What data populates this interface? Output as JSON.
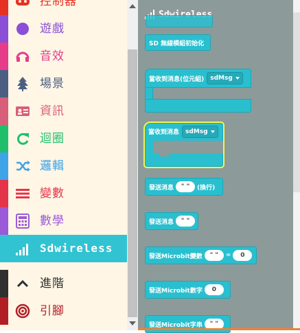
{
  "toolbox": {
    "categories": [
      {
        "id": "controller",
        "label": "控制器",
        "color": "#e63022",
        "icon": "gamepad-icon"
      },
      {
        "id": "game",
        "label": "遊戲",
        "color": "#8a4fd6",
        "icon": "circle-icon"
      },
      {
        "id": "music",
        "label": "音效",
        "color": "#e63c8a",
        "icon": "headphones-icon"
      },
      {
        "id": "scene",
        "label": "場景",
        "color": "#4c5f82",
        "icon": "tree-icon"
      },
      {
        "id": "info",
        "label": "資訊",
        "color": "#d75f7a",
        "icon": "id-card-icon"
      },
      {
        "id": "loops",
        "label": "迴圈",
        "color": "#20bf6b",
        "icon": "refresh-icon"
      },
      {
        "id": "logic",
        "label": "邏輯",
        "color": "#3fa3e8",
        "icon": "shuffle-icon"
      },
      {
        "id": "variables",
        "label": "變數",
        "color": "#e5344a",
        "icon": "list-icon"
      },
      {
        "id": "math",
        "label": "數學",
        "color": "#9b5ad8",
        "icon": "calculator-icon"
      },
      {
        "id": "sdwireless",
        "label": "Sdwireless",
        "color": "#31c3d2",
        "icon": "signal-icon"
      },
      {
        "id": "advanced",
        "label": "進階",
        "color": "#2f2f2f",
        "icon": "chevron-up-icon"
      },
      {
        "id": "pins",
        "label": "引腳",
        "color": "#b21e25",
        "icon": "target-icon"
      }
    ]
  },
  "flyout": {
    "title": "Sdwireless",
    "title_icon": "signal-icon",
    "blocks": {
      "init": "SD 無線模組初始化",
      "on_recv_bytes": "當收到消息(位元組)",
      "on_recv_bytes_dd": "sdMsg",
      "on_recv": "當收到消息",
      "on_recv_dd": "sdMsg",
      "send_newline": "發送消息",
      "send_newline_suffix": "(換行)",
      "send_newline_val": "\" \"",
      "send": "發送消息",
      "send_val": "\" \"",
      "send_var": "發送Microbit變數",
      "send_var_name": "\" \"",
      "send_var_eq": "=",
      "send_var_val": "0",
      "send_num": "發送Microbit數字",
      "send_num_val": "0",
      "send_str": "發送Microbit字串",
      "send_str_val": "\" \""
    }
  }
}
